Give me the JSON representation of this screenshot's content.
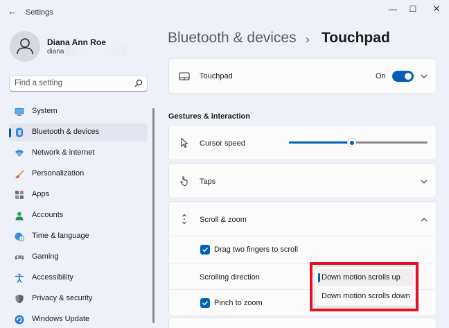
{
  "window": {
    "title": "Settings",
    "back_glyph": "←",
    "min_glyph": "—",
    "max_glyph": "☐",
    "close_glyph": "✕"
  },
  "user": {
    "name": "Diana Ann Roe",
    "email": "diana"
  },
  "search": {
    "placeholder": "Find a setting",
    "icon": "search-icon"
  },
  "sidebar": {
    "items": [
      {
        "label": "System",
        "icon": "monitor-icon",
        "active": false
      },
      {
        "label": "Bluetooth & devices",
        "icon": "bluetooth-icon",
        "active": true
      },
      {
        "label": "Network & internet",
        "icon": "wifi-icon",
        "active": false
      },
      {
        "label": "Personalization",
        "icon": "brush-icon",
        "active": false
      },
      {
        "label": "Apps",
        "icon": "apps-icon",
        "active": false
      },
      {
        "label": "Accounts",
        "icon": "person-icon",
        "active": false
      },
      {
        "label": "Time & language",
        "icon": "globe-clock-icon",
        "active": false
      },
      {
        "label": "Gaming",
        "icon": "gamepad-icon",
        "active": false
      },
      {
        "label": "Accessibility",
        "icon": "accessibility-icon",
        "active": false
      },
      {
        "label": "Privacy & security",
        "icon": "shield-icon",
        "active": false
      },
      {
        "label": "Windows Update",
        "icon": "update-icon",
        "active": false
      }
    ]
  },
  "breadcrumb": {
    "parent": "Bluetooth & devices",
    "separator": "›",
    "current": "Touchpad"
  },
  "touchpad": {
    "label": "Touchpad",
    "state": "On",
    "enabled": true
  },
  "gestures": {
    "section_title": "Gestures & interaction",
    "cursor_speed": {
      "label": "Cursor speed",
      "value": 0.45
    },
    "taps": {
      "label": "Taps"
    },
    "scroll_zoom": {
      "label": "Scroll & zoom",
      "drag_two_fingers": {
        "label": "Drag two fingers to scroll",
        "checked": true
      },
      "scrolling_direction": {
        "label": "Scrolling direction",
        "options": [
          "Down motion scrolls up",
          "Down motion scrolls down"
        ],
        "selected_index": 0
      },
      "pinch_to_zoom": {
        "label": "Pinch to zoom",
        "checked": true
      }
    }
  },
  "colors": {
    "accent": "#005fb8",
    "highlight": "#e81123",
    "background": "#eef1f7",
    "card": "#fbfbfc"
  }
}
